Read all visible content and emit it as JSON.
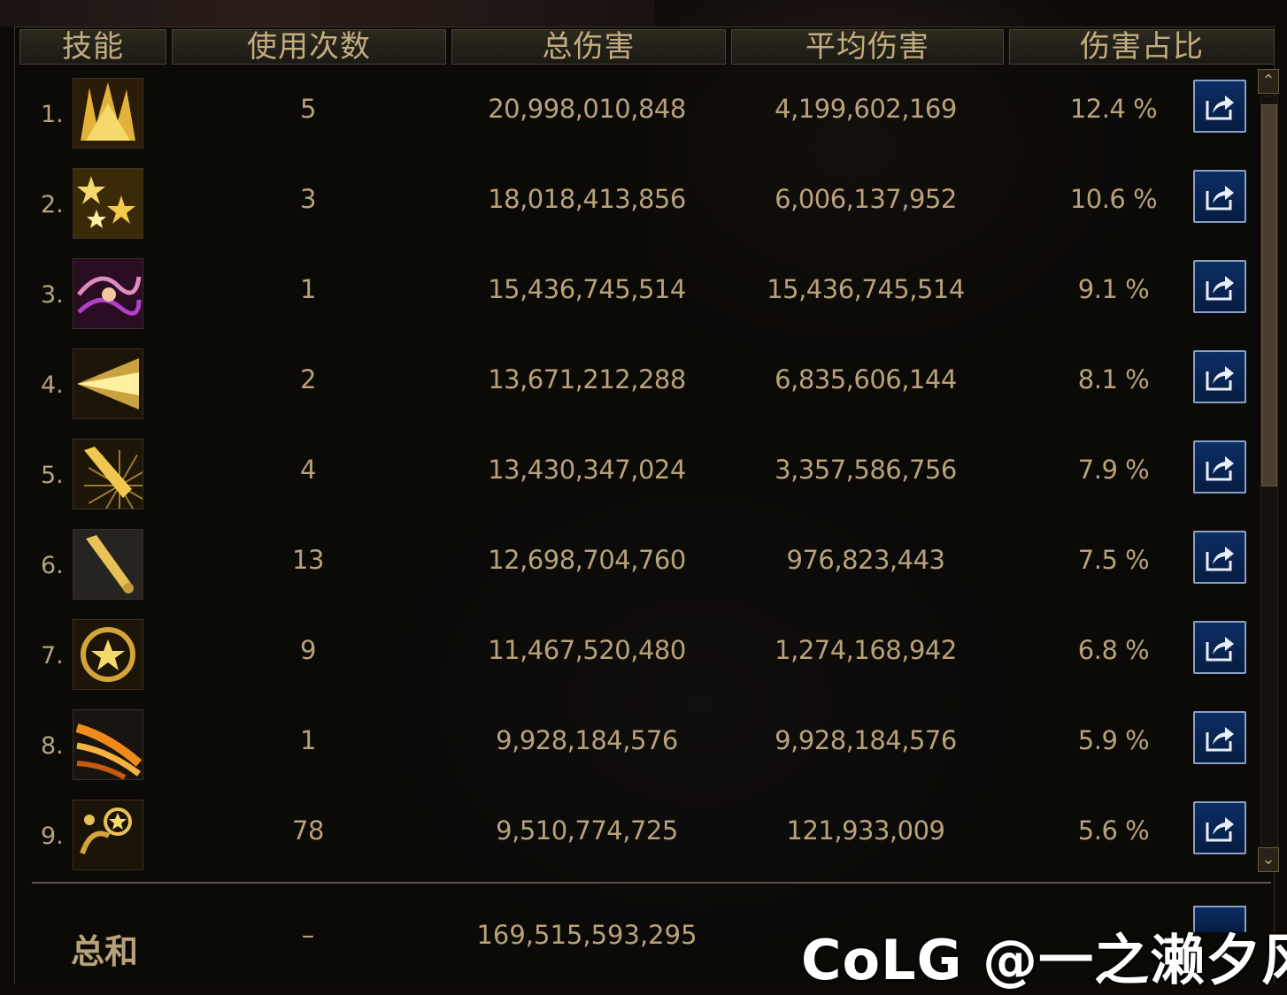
{
  "columns": {
    "skill": "技能",
    "uses": "使用次数",
    "total": "总伤害",
    "average": "平均伤害",
    "share": "伤害占比"
  },
  "rows": [
    {
      "rank": "1.",
      "uses": "5",
      "total": "20,998,010,848",
      "average": "4,199,602,169",
      "pct": "12.4 %",
      "icon": "golden-burst-skill-icon"
    },
    {
      "rank": "2.",
      "uses": "3",
      "total": "18,018,413,856",
      "average": "6,006,137,952",
      "pct": "10.6 %",
      "icon": "stars-skill-icon"
    },
    {
      "rank": "3.",
      "uses": "1",
      "total": "15,436,745,514",
      "average": "15,436,745,514",
      "pct": "9.1 %",
      "icon": "purple-spark-skill-icon"
    },
    {
      "rank": "4.",
      "uses": "2",
      "total": "13,671,212,288",
      "average": "6,835,606,144",
      "pct": "8.1 %",
      "icon": "light-rays-skill-icon"
    },
    {
      "rank": "5.",
      "uses": "4",
      "total": "13,430,347,024",
      "average": "3,357,586,756",
      "pct": "7.9 %",
      "icon": "bat-swing-skill-icon"
    },
    {
      "rank": "6.",
      "uses": "13",
      "total": "12,698,704,760",
      "average": "976,823,443",
      "pct": "7.5 %",
      "icon": "bat-skill-icon"
    },
    {
      "rank": "7.",
      "uses": "9",
      "total": "11,467,520,480",
      "average": "1,274,168,942",
      "pct": "6.8 %",
      "icon": "star-swirl-skill-icon"
    },
    {
      "rank": "8.",
      "uses": "1",
      "total": "9,928,184,576",
      "average": "9,928,184,576",
      "pct": "5.9 %",
      "icon": "orange-slash-skill-icon"
    },
    {
      "rank": "9.",
      "uses": "78",
      "total": "9,510,774,725",
      "average": "121,933,009",
      "pct": "5.6 %",
      "icon": "star-ball-skill-icon"
    }
  ],
  "summary": {
    "label": "总和",
    "uses": "–",
    "total": "169,515,593,295"
  },
  "scroll": {
    "up": "⌃",
    "down": "⌄"
  },
  "watermark": "CoLG @一之濑夕风",
  "colors": {
    "text": "#b8a27a",
    "header_text": "#c2ad7f",
    "button_bg": "#0c2e63",
    "button_border": "#8aa0c6"
  }
}
